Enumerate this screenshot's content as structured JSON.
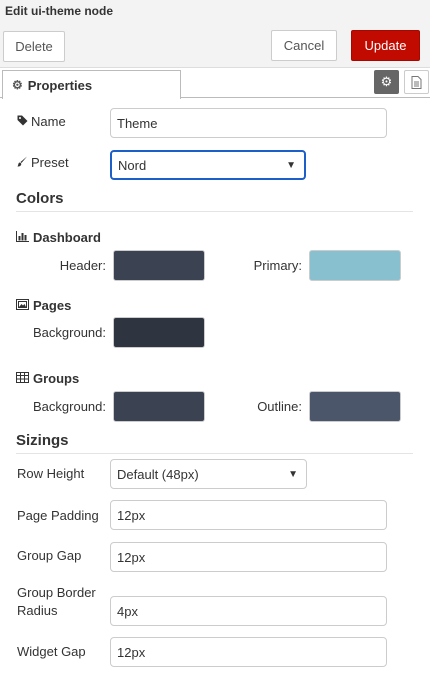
{
  "window": {
    "title": "Edit ui-theme node"
  },
  "toolbar": {
    "delete_label": "Delete",
    "cancel_label": "Cancel",
    "update_label": "Update"
  },
  "tabs": [
    {
      "label": "Properties",
      "icon": "gear-icon",
      "active": true
    }
  ],
  "tab_tools": [
    {
      "icon": "gear-icon",
      "active": true
    },
    {
      "icon": "document-icon",
      "active": false
    }
  ],
  "fields": {
    "name": {
      "label": "Name",
      "icon": "tag-icon",
      "value": "Theme"
    },
    "preset": {
      "label": "Preset",
      "icon": "paintbrush-icon",
      "value": "Nord"
    }
  },
  "colors": {
    "heading": "Colors",
    "dashboard": {
      "label": "Dashboard",
      "icon": "bar-chart-icon",
      "header_label": "Header:",
      "header_color": "#3b4252",
      "primary_label": "Primary:",
      "primary_color": "#88c0d0"
    },
    "pages": {
      "label": "Pages",
      "icon": "picture-icon",
      "background_label": "Background:",
      "background_color": "#2e3440"
    },
    "groups": {
      "label": "Groups",
      "icon": "table-icon",
      "background_label": "Background:",
      "background_color": "#3b4252",
      "outline_label": "Outline:",
      "outline_color": "#4c566a"
    }
  },
  "sizings": {
    "heading": "Sizings",
    "row_height": {
      "label": "Row Height",
      "value": "Default (48px)"
    },
    "page_padding": {
      "label": "Page Padding",
      "value": "12px"
    },
    "group_gap": {
      "label": "Group Gap",
      "value": "12px"
    },
    "group_border_radius": {
      "label_line1": "Group Border",
      "label_line2": "Radius",
      "value": "4px"
    },
    "widget_gap": {
      "label": "Widget Gap",
      "value": "12px"
    }
  },
  "accent": {
    "update_button": "#c10b00",
    "focus_ring": "#1d5fc9"
  }
}
